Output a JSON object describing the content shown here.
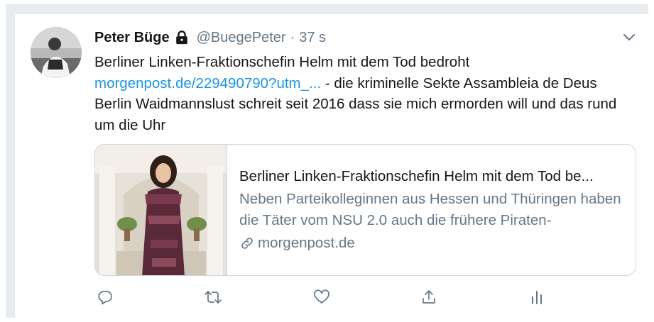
{
  "tweet": {
    "author_name": "Peter Büge",
    "author_handle": "@BuegePeter",
    "separator": "·",
    "time": "37 s",
    "text_before_link": "Berliner Linken-Fraktionschefin Helm mit dem Tod bedroht",
    "link_text": "morgenpost.de/229490790?utm_...",
    "text_after_link": " - die kriminelle Sekte Assambleia de Deus Berlin Waidmannslust schreit seit 2016 dass sie mich ermorden will und das rund um die Uhr"
  },
  "link_card": {
    "title": "Berliner Linken-Fraktionschefin Helm mit dem Tod be...",
    "description": "Neben Parteikolleginnen aus Hessen und Thüringen haben die Täter vom NSU 2.0 auch die frühere Piraten-",
    "domain": "morgenpost.de"
  },
  "icons": {
    "lock": "lock-icon",
    "caret": "chevron-down-icon",
    "reply": "reply-icon",
    "retweet": "retweet-icon",
    "like": "heart-icon",
    "share": "share-icon",
    "analytics": "analytics-icon",
    "link": "link-icon"
  },
  "colors": {
    "text": "#14171a",
    "secondary": "#657786",
    "link": "#1b95e0",
    "border": "#ccd6dd"
  }
}
